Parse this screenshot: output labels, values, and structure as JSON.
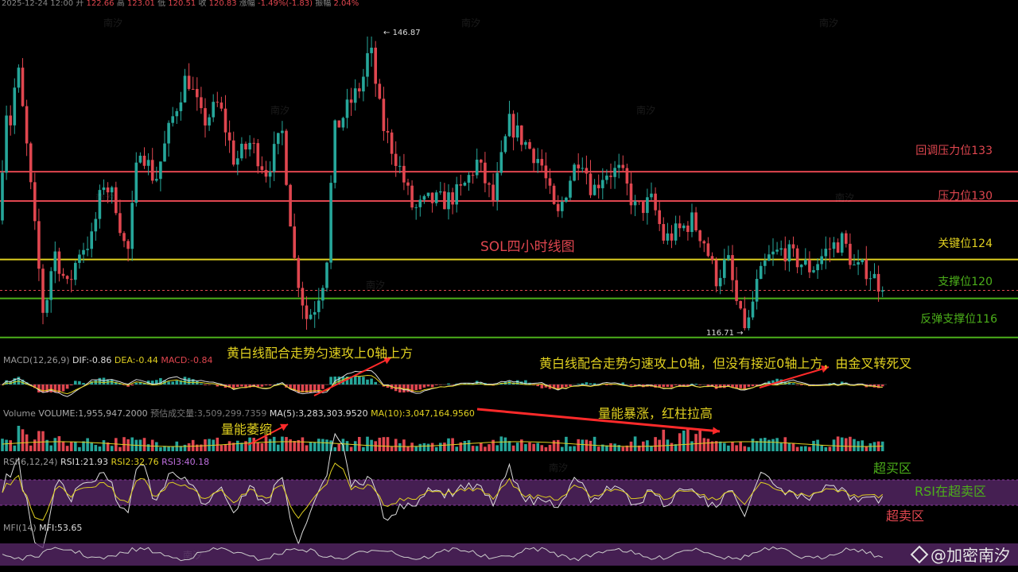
{
  "header": {
    "datetime": "2025-12-24 12:00",
    "open_label": "开",
    "open": "122.66",
    "high_label": "高",
    "high": "123.01",
    "low_label": "低",
    "low": "120.51",
    "close_label": "收",
    "close": "120.83",
    "change_label": "涨幅",
    "change": "-1.49%(-1.83)",
    "amp_label": "振幅",
    "amp": "2.04%"
  },
  "chart_data": {
    "type": "candlestick",
    "title": "SOL四小时线图",
    "ylim": [
      114.5,
      149
    ],
    "high_marker": 146.87,
    "low_marker": 116.71,
    "close_points": [
      [
        0,
        128
      ],
      [
        6,
        140
      ],
      [
        13,
        138
      ],
      [
        22,
        144
      ],
      [
        33,
        136
      ],
      [
        45,
        126
      ],
      [
        55,
        118
      ],
      [
        68,
        125
      ],
      [
        85,
        121
      ],
      [
        100,
        125
      ],
      [
        115,
        126
      ],
      [
        130,
        132
      ],
      [
        145,
        130
      ],
      [
        160,
        124
      ],
      [
        175,
        136
      ],
      [
        195,
        132
      ],
      [
        215,
        138
      ],
      [
        235,
        143
      ],
      [
        255,
        138
      ],
      [
        275,
        140
      ],
      [
        295,
        134
      ],
      [
        315,
        136
      ],
      [
        335,
        133
      ],
      [
        355,
        137
      ],
      [
        370,
        124
      ],
      [
        385,
        118
      ],
      [
        395,
        119
      ],
      [
        410,
        123
      ],
      [
        420,
        137
      ],
      [
        440,
        140
      ],
      [
        455,
        142
      ],
      [
        465,
        146
      ],
      [
        480,
        138
      ],
      [
        500,
        134
      ],
      [
        520,
        129
      ],
      [
        540,
        130
      ],
      [
        560,
        130
      ],
      [
        580,
        131
      ],
      [
        600,
        134
      ],
      [
        620,
        130
      ],
      [
        640,
        138
      ],
      [
        660,
        136
      ],
      [
        680,
        134
      ],
      [
        690,
        131
      ],
      [
        700,
        128
      ],
      [
        715,
        132
      ],
      [
        730,
        135
      ],
      [
        745,
        131
      ],
      [
        760,
        133
      ],
      [
        780,
        133
      ],
      [
        800,
        129
      ],
      [
        820,
        130
      ],
      [
        835,
        126
      ],
      [
        855,
        127
      ],
      [
        870,
        128
      ],
      [
        885,
        126
      ],
      [
        900,
        122
      ],
      [
        915,
        124
      ],
      [
        930,
        118
      ],
      [
        940,
        117
      ],
      [
        950,
        121
      ],
      [
        965,
        124
      ],
      [
        985,
        125
      ],
      [
        1000,
        124
      ],
      [
        1020,
        123
      ],
      [
        1040,
        125
      ],
      [
        1060,
        126
      ],
      [
        1075,
        123
      ],
      [
        1090,
        123
      ],
      [
        1100,
        122
      ],
      [
        1112,
        120.83
      ]
    ],
    "levels": [
      {
        "label": "回调压力位133",
        "value": 133,
        "color": "#e0464f"
      },
      {
        "label": "压力位130",
        "value": 130,
        "color": "#e0464f"
      },
      {
        "label": "关键位124",
        "value": 124,
        "color": "#e0d020"
      },
      {
        "label": "支撑位120",
        "value": 120,
        "color": "#4caf1a"
      },
      {
        "label": "反弹支撑位116",
        "value": 116,
        "color": "#4caf1a"
      }
    ],
    "last_price": 120.83
  },
  "macd": {
    "name": "MACD(12,26,9)",
    "dif": "DIF:-0.86",
    "dea": "DEA:-0.44",
    "macd": "MACD:-0.84"
  },
  "volume": {
    "name": "Volume",
    "volume": "VOLUME:1,955,947.2000",
    "est": "预估成交量:3,509,299.7359",
    "ma5": "MA(5):3,283,303.9520",
    "ma10": "MA(10):3,047,164.9560"
  },
  "rsi": {
    "name": "RSI(6,12,24)",
    "rsi1": "RSI1:21.93",
    "rsi2": "RSI2:32.76",
    "rsi3": "RSI3:40.18"
  },
  "mfi": {
    "name": "MFI(14)",
    "value": "MFI:53.65"
  },
  "annotations": {
    "macd_note1": "黄白线配合走势匀速攻上0轴上方",
    "macd_note2": "黄白线配合走势匀速攻上0轴，但没有接近0轴上方，由金叉转死叉",
    "vol_note1": "量能萎缩",
    "vol_note2": "量能暴涨，红柱拉高",
    "overbought": "超买区",
    "rsi_note": "RSI在超卖区",
    "oversold": "超卖区"
  },
  "watermark": "南汐",
  "brand": "@加密南汐",
  "colors": {
    "up": "#26a69a",
    "down": "#e0464f",
    "yellow": "#e0d020",
    "green": "#4caf1a",
    "purple": "#5c2a6e"
  }
}
